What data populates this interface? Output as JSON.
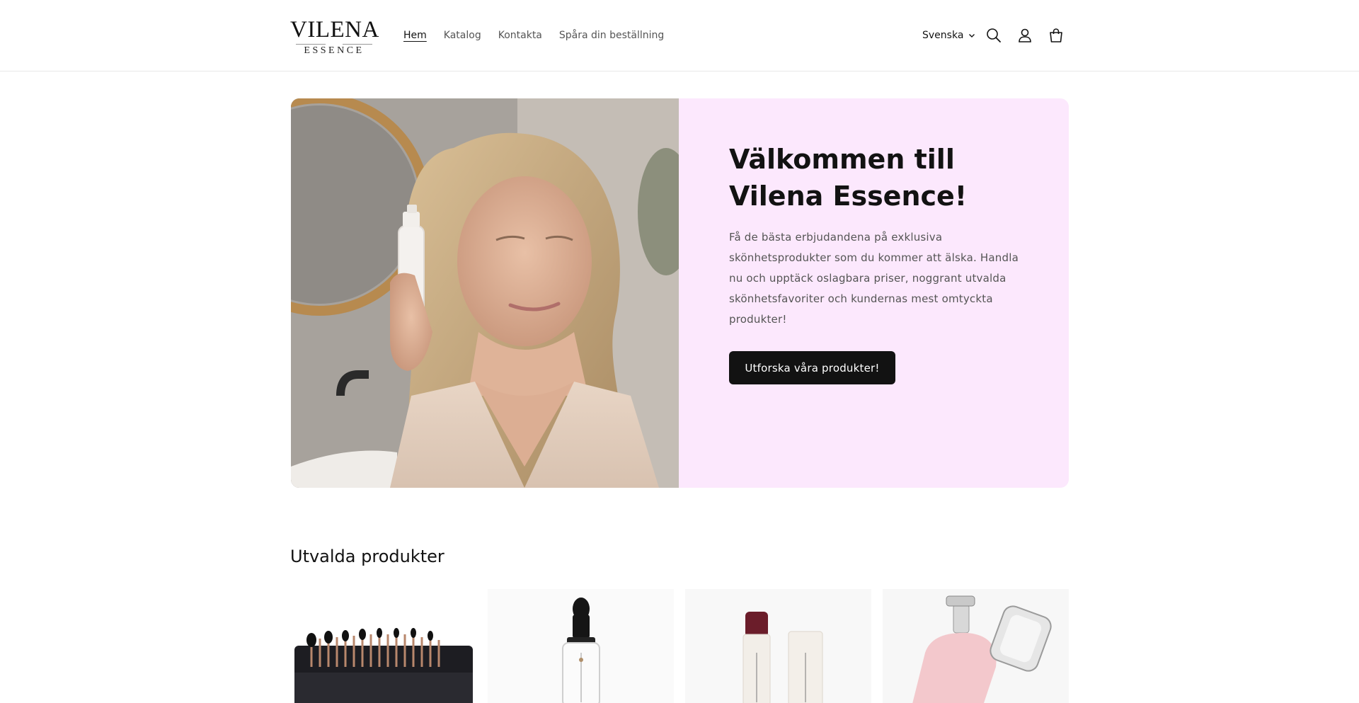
{
  "header": {
    "logo": {
      "main": "VILENA",
      "sub": "ESSENCE"
    },
    "nav": [
      {
        "label": "Hem",
        "active": true
      },
      {
        "label": "Katalog",
        "active": false
      },
      {
        "label": "Kontakta",
        "active": false
      },
      {
        "label": "Spåra din beställning",
        "active": false
      }
    ],
    "language": "Svenska",
    "icons": [
      "search-icon",
      "account-icon",
      "cart-icon"
    ]
  },
  "hero": {
    "title": "Välkommen till Vilena Essence!",
    "body": "Få de bästa erbjudandena på exklusiva skönhetsprodukter som du kommer att älska. Handla nu och upptäck oslagbara priser, noggrant utvalda skönhetsfavoriter och kundernas mest omtyckta produkter!",
    "cta_label": "Utforska våra produkter!",
    "panel_color": "#fce8fd"
  },
  "featured": {
    "title": "Utvalda produkter",
    "products": [
      {
        "image": "makeup-brush-set-image"
      },
      {
        "image": "serum-dropper-bottle-image"
      },
      {
        "image": "lip-balm-sticks-image"
      },
      {
        "image": "pump-bottle-image"
      }
    ]
  },
  "colors": {
    "accent": "#121212",
    "muted_text": "#555555"
  }
}
